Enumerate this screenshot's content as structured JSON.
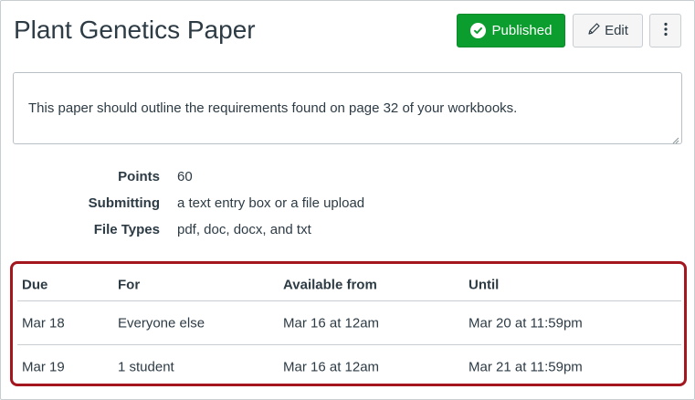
{
  "page": {
    "title": "Plant Genetics Paper"
  },
  "toolbar": {
    "published_label": "Published",
    "edit_label": "Edit",
    "more_label": "⋮"
  },
  "description": {
    "text": "This paper should outline the requirements found on page 32 of your workbooks."
  },
  "details": [
    {
      "label": "Points",
      "value": "60"
    },
    {
      "label": "Submitting",
      "value": "a text entry box or a file upload"
    },
    {
      "label": "File Types",
      "value": "pdf, doc, docx, and txt"
    }
  ],
  "dates_table": {
    "headers": [
      "Due",
      "For",
      "Available from",
      "Until"
    ],
    "rows": [
      [
        "Mar 18",
        "Everyone else",
        "Mar 16 at 12am",
        "Mar 20 at 11:59pm"
      ],
      [
        "Mar 19",
        "1 student",
        "Mar 16 at 12am",
        "Mar 21 at 11:59pm"
      ]
    ]
  },
  "colors": {
    "published_green": "#0b9e2f",
    "highlight_red": "#a3161e",
    "text": "#2d3b45"
  },
  "icons": {
    "published": "check-circle-icon",
    "edit": "pencil-icon",
    "more": "kebab-menu-icon"
  }
}
